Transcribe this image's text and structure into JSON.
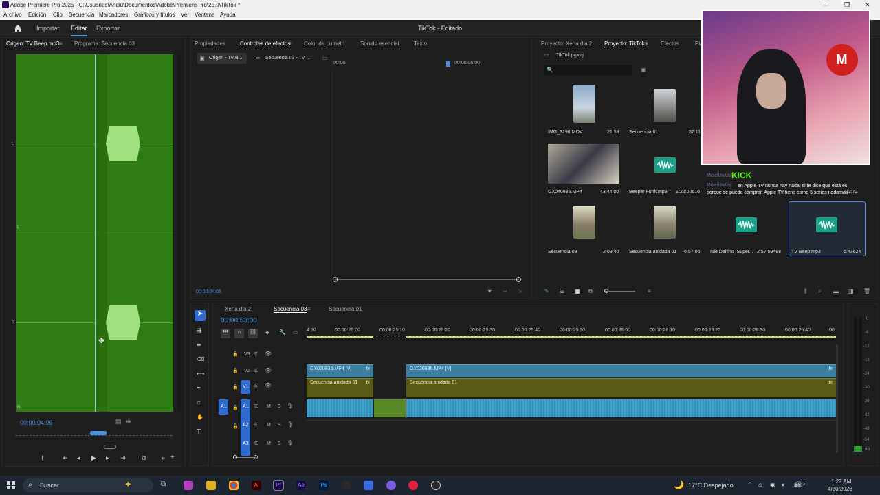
{
  "window": {
    "title": "Adobe Premiere Pro 2025 - C:\\Usuarios\\Andiu\\Documentos\\Adobe\\Premiere Pro\\25.0\\TikTok *"
  },
  "menu": [
    "Archivo",
    "Edición",
    "Clip",
    "Secuencia",
    "Marcadores",
    "Gráficos y títulos",
    "Ver",
    "Ventana",
    "Ayuda"
  ],
  "workspace": {
    "importar": "Importar",
    "editar": "Editar",
    "exportar": "Exportar",
    "project_title": "TikTok - Editado"
  },
  "source_panel": {
    "tab_origen": "Origen: TV Beep.mp3",
    "tab_programa": "Programa: Secuencia 03",
    "timecode": "00:00:04:06",
    "channel_l": "L",
    "channel_r": "R"
  },
  "effects_panel": {
    "tabs": [
      "Propiedades",
      "Controles de efectos",
      "Color de Lumetri",
      "Sonido esencial",
      "Texto"
    ],
    "sub_origen": "Origen - TV B...",
    "sub_secuencia": "Secuencia 03 - TV ...",
    "ruler_start": ":00:00",
    "ruler_mark": "00:00:05:00",
    "timecode": "00:00:04:06"
  },
  "project_panel": {
    "tabs": [
      "Proyecto: Xena dia 2",
      "Proyecto: TikTok",
      "Efectos",
      "Pla"
    ],
    "file": "TikTok.prproj",
    "items": [
      {
        "name": "IMG_3296.MOV",
        "dur": "21:58"
      },
      {
        "name": "Secuencia 01",
        "dur": "57:11"
      },
      {
        "name": "GX040935.MP4",
        "dur": "43:44:00"
      },
      {
        "name": "Beeper Funk.mp3",
        "dur": "1:22:02616"
      },
      {
        "name": "",
        "dur": "1:3:72"
      },
      {
        "name": "Secuencia 03",
        "dur": "2:09:40"
      },
      {
        "name": "Secuencia anidada 01",
        "dur": "6:57:06"
      },
      {
        "name": "Isle Delfino_Super...",
        "dur": "2:57:09468"
      },
      {
        "name": "TV Beep.mp3",
        "dur": "6:43624"
      }
    ]
  },
  "chat": {
    "kick": "KICK",
    "user1": "MoielUwUs",
    "user2": "MoielUwUs:",
    "message": "en Apple TV nunca hay nada, si te dice que está es porque se puede comprar, Apple TV tiene como 5 series nadamas"
  },
  "timeline": {
    "tabs": [
      "Xena dia 2",
      "Secuencia 03",
      "Secuencia 01"
    ],
    "timecode": "00:00:53:00",
    "ruler": [
      "4:50",
      "00:00:25:00",
      "00:00:25:10",
      "00:00:25:20",
      "00:00:25:30",
      "00:00:25:40",
      "00:00:25:50",
      "00:00:26:00",
      "00:00:26:10",
      "00:00:26:20",
      "00:00:26:30",
      "00:00:26:40",
      "00"
    ],
    "tracks": {
      "v3": "V3",
      "v2": "V2",
      "v1": "V1",
      "a1": "A1",
      "a2": "A2",
      "a3": "A3",
      "a1src": "A1"
    },
    "clips": {
      "v2a": "GX020935.MP4 [V]",
      "v2b": "GX020935.MP4 [V]",
      "v1a": "Secuencia anidada 01",
      "v1b": "Secuencia anidada 01"
    },
    "meter_labels": [
      "0",
      "-6",
      "-12",
      "-18",
      "-24",
      "-30",
      "-36",
      "-42",
      "-48",
      "-54",
      "dB"
    ],
    "ms": "M",
    "s": "S"
  },
  "taskbar": {
    "search": "Buscar",
    "weather": "17°C  Despejado",
    "lang": "ESP",
    "time": "1:27 AM",
    "date": "4/30/2026"
  }
}
